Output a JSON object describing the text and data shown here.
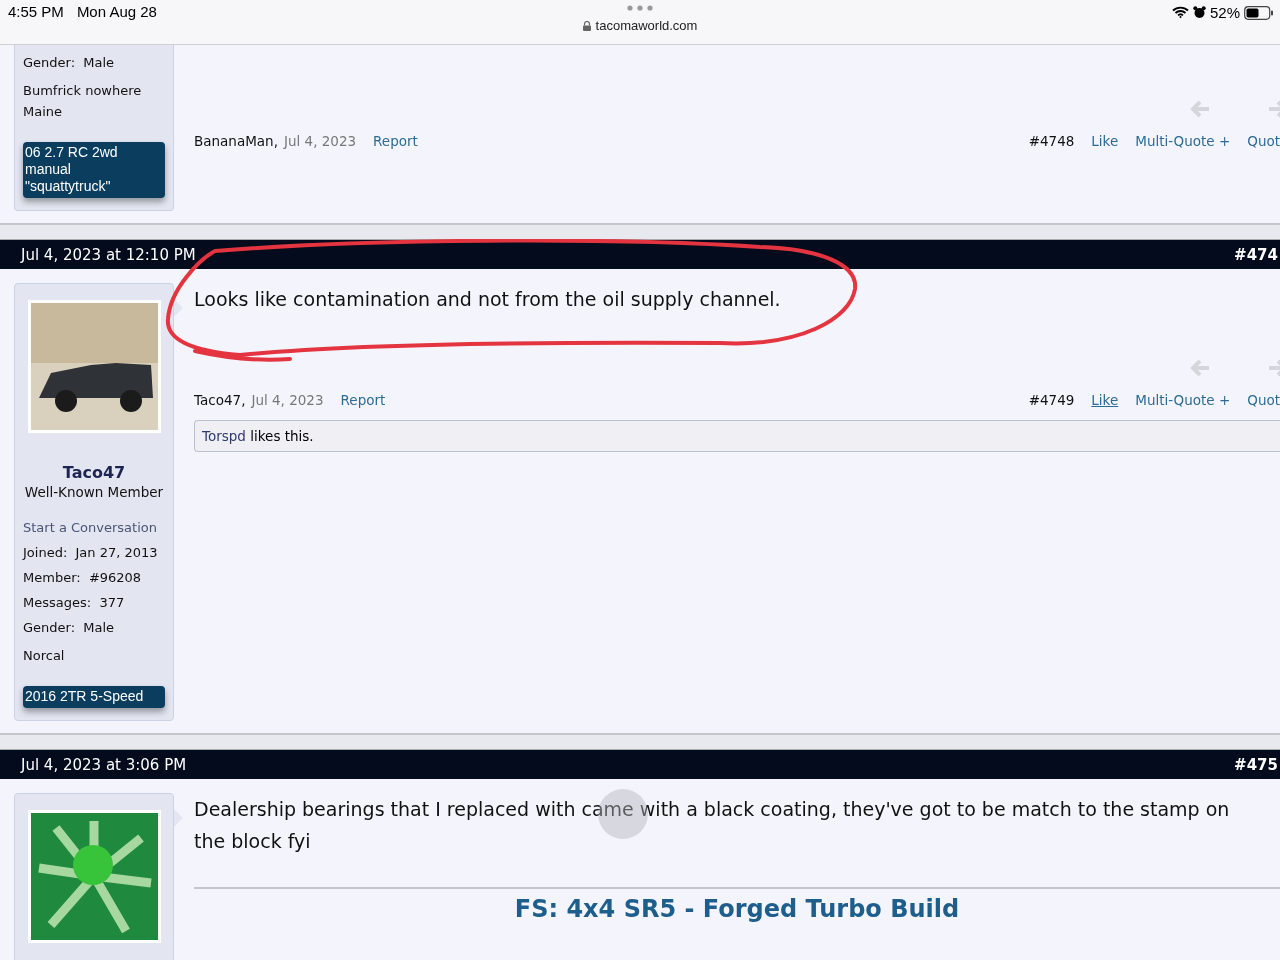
{
  "status_bar": {
    "time": "4:55 PM",
    "date": "Mon Aug 28",
    "url": "tacomaworld.com",
    "battery": "52%"
  },
  "posts": [
    {
      "stats": [
        {
          "label": "Gender:",
          "value": "Male"
        }
      ],
      "location": "Bumfrick nowhere Maine",
      "badge": "06 2.7 RC 2wd manual \"squattytruck\"",
      "footer": {
        "author": "BananaMan,",
        "date": "Jul 4, 2023",
        "report": "Report",
        "number": "#4748",
        "actions": [
          {
            "label": "Like",
            "underlined": false
          },
          {
            "label": "Multi-Quote +",
            "underlined": false
          },
          {
            "label": "Quot",
            "underlined": false
          }
        ]
      }
    },
    {
      "header": {
        "date": "Jul 4, 2023 at 12:10 PM",
        "number": "#474"
      },
      "avatar": {
        "kind": "photo"
      },
      "name": "Taco47",
      "title": "Well-Known Member",
      "link": "Start a Conversation",
      "stats": [
        {
          "label": "Joined:",
          "value": "Jan 27, 2013"
        },
        {
          "label": "Member:",
          "value": "#96208"
        },
        {
          "label": "Messages:",
          "value": "377"
        },
        {
          "label": "Gender:",
          "value": "Male"
        }
      ],
      "location": "Norcal",
      "badge": "2016 2TR 5-Speed",
      "message": "Looks like contamination and not from the oil supply channel.",
      "circled": true,
      "footer": {
        "author": "Taco47,",
        "date": "Jul 4, 2023",
        "report": "Report",
        "number": "#4749",
        "actions": [
          {
            "label": "Like",
            "underlined": true
          },
          {
            "label": "Multi-Quote +",
            "underlined": false
          },
          {
            "label": "Quot",
            "underlined": false
          }
        ]
      },
      "likes": {
        "user": "Torspd",
        "text": "likes this."
      }
    },
    {
      "header": {
        "date": "Jul 4, 2023 at 3:06 PM",
        "number": "#475"
      },
      "avatar": {
        "kind": "illustration"
      },
      "message": "Dealership bearings that I replaced with came with a black coating, they've got to be match to the stamp on the block fyi",
      "touch_indicator": true,
      "signature": "FS: 4x4 SR5 - Forged Turbo Build"
    }
  ]
}
